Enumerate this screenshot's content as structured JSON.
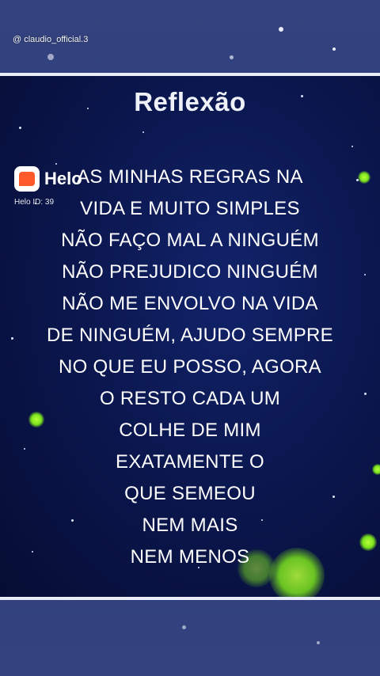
{
  "watermark": "@ claudio_official.3",
  "title": "Reflexão",
  "poem_lines": [
    "AS MINHAS REGRAS NA",
    "VIDA E MUITO SIMPLES",
    "NÃO FAÇO MAL A NINGUÉM",
    "NÃO PREJUDICO NINGUÉM",
    "NÃO ME ENVOLVO NA VIDA",
    "DE NINGUÉM, AJUDO SEMPRE",
    "NO QUE EU POSSO, AGORA",
    "O RESTO CADA UM",
    "COLHE DE MIM",
    "EXATAMENTE O",
    "QUE SEMEOU",
    "NEM MAIS",
    "NEM MENOS"
  ],
  "helo": {
    "name": "Helo",
    "id_label": "Helo ID: 39"
  },
  "colors": {
    "page_bg": "#2c3b78",
    "card_bg": "#0b174f",
    "text": "#ffffff",
    "glow": "#7ae21c",
    "helo_logo": "#ff5a2a"
  },
  "icons": {
    "helo_logo": "helo-logo-icon"
  }
}
